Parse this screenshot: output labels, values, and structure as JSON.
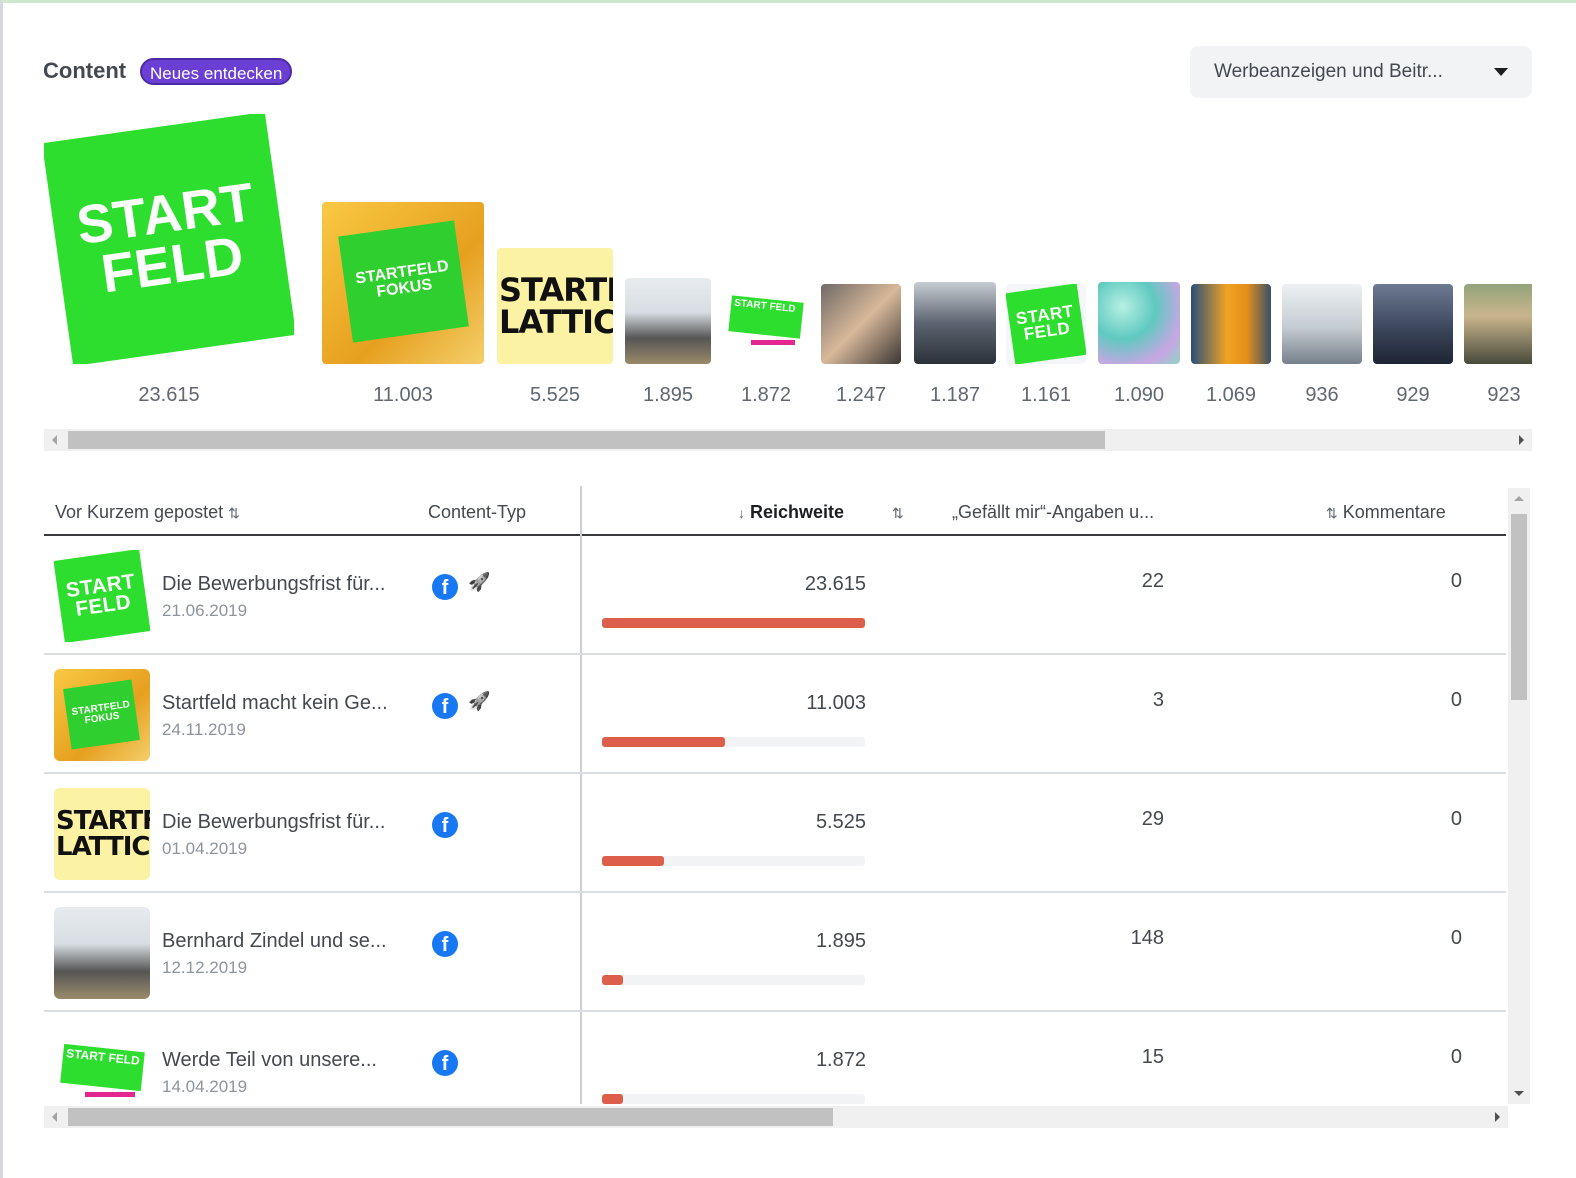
{
  "header": {
    "title": "Content",
    "badge": "Neues entdecken",
    "dropdown_value": "Werbeanzeigen und Beitr..."
  },
  "strip": {
    "items": [
      {
        "kind": "startfeld",
        "value": "23.615",
        "logo_text": "START FELD"
      },
      {
        "kind": "fokus",
        "value": "11.003",
        "logo_text": "STARTFELD FOKUS"
      },
      {
        "kind": "lattich",
        "value": "5.525",
        "logo_text": "STARTFELD LATTICH"
      },
      {
        "kind": "office",
        "value": "1.895"
      },
      {
        "kind": "pink",
        "value": "1.872",
        "logo_text": "START FELD"
      },
      {
        "kind": "hand",
        "value": "1.247"
      },
      {
        "kind": "crowd",
        "value": "1.187"
      },
      {
        "kind": "startfeld",
        "value": "1.161",
        "logo_text": "START FELD"
      },
      {
        "kind": "aqua",
        "value": "1.090"
      },
      {
        "kind": "woman",
        "value": "1.069"
      },
      {
        "kind": "meet",
        "value": "936"
      },
      {
        "kind": "hall",
        "value": "929"
      },
      {
        "kind": "man",
        "value": "923"
      }
    ],
    "scroll_position": 0.72
  },
  "table": {
    "headers": {
      "posted": "Vor Kurzem gepostet",
      "content_type": "Content-Typ",
      "reach": "Reichweite",
      "likes": "„Gefällt mir“-Angaben u...",
      "comments": "Kommentare"
    },
    "max_reach": 23615,
    "rows": [
      {
        "title": "Die Bewerbungsfrist für...",
        "date": "21.06.2019",
        "reach": "23.615",
        "reach_value": 23615,
        "likes": "22",
        "comments": "0",
        "boosted": true,
        "thumb": "startfeld"
      },
      {
        "title": "Startfeld macht kein Ge...",
        "date": "24.11.2019",
        "reach": "11.003",
        "reach_value": 11003,
        "likes": "3",
        "comments": "0",
        "boosted": true,
        "thumb": "fokus"
      },
      {
        "title": "Die Bewerbungsfrist für...",
        "date": "01.04.2019",
        "reach": "5.525",
        "reach_value": 5525,
        "likes": "29",
        "comments": "0",
        "boosted": false,
        "thumb": "lattich"
      },
      {
        "title": "Bernhard Zindel und se...",
        "date": "12.12.2019",
        "reach": "1.895",
        "reach_value": 1895,
        "likes": "148",
        "comments": "0",
        "boosted": false,
        "thumb": "office"
      },
      {
        "title": "Werde Teil von unsere...",
        "date": "14.04.2019",
        "reach": "1.872",
        "reach_value": 1872,
        "likes": "15",
        "comments": "0",
        "boosted": false,
        "thumb": "pink"
      }
    ],
    "hscroll_position": 0.54,
    "vscroll_position": 0.33
  },
  "colors": {
    "accent": "#6b3fd4",
    "facebook": "#1877f2",
    "bar": "#dd5e4a",
    "startfeld_green": "#2ede2e"
  },
  "icons": {
    "sort": "sort-arrows-icon",
    "sort_desc": "arrow-down-icon",
    "facebook": "facebook-icon",
    "boost": "rocket-icon",
    "dropdown": "caret-down-icon"
  }
}
